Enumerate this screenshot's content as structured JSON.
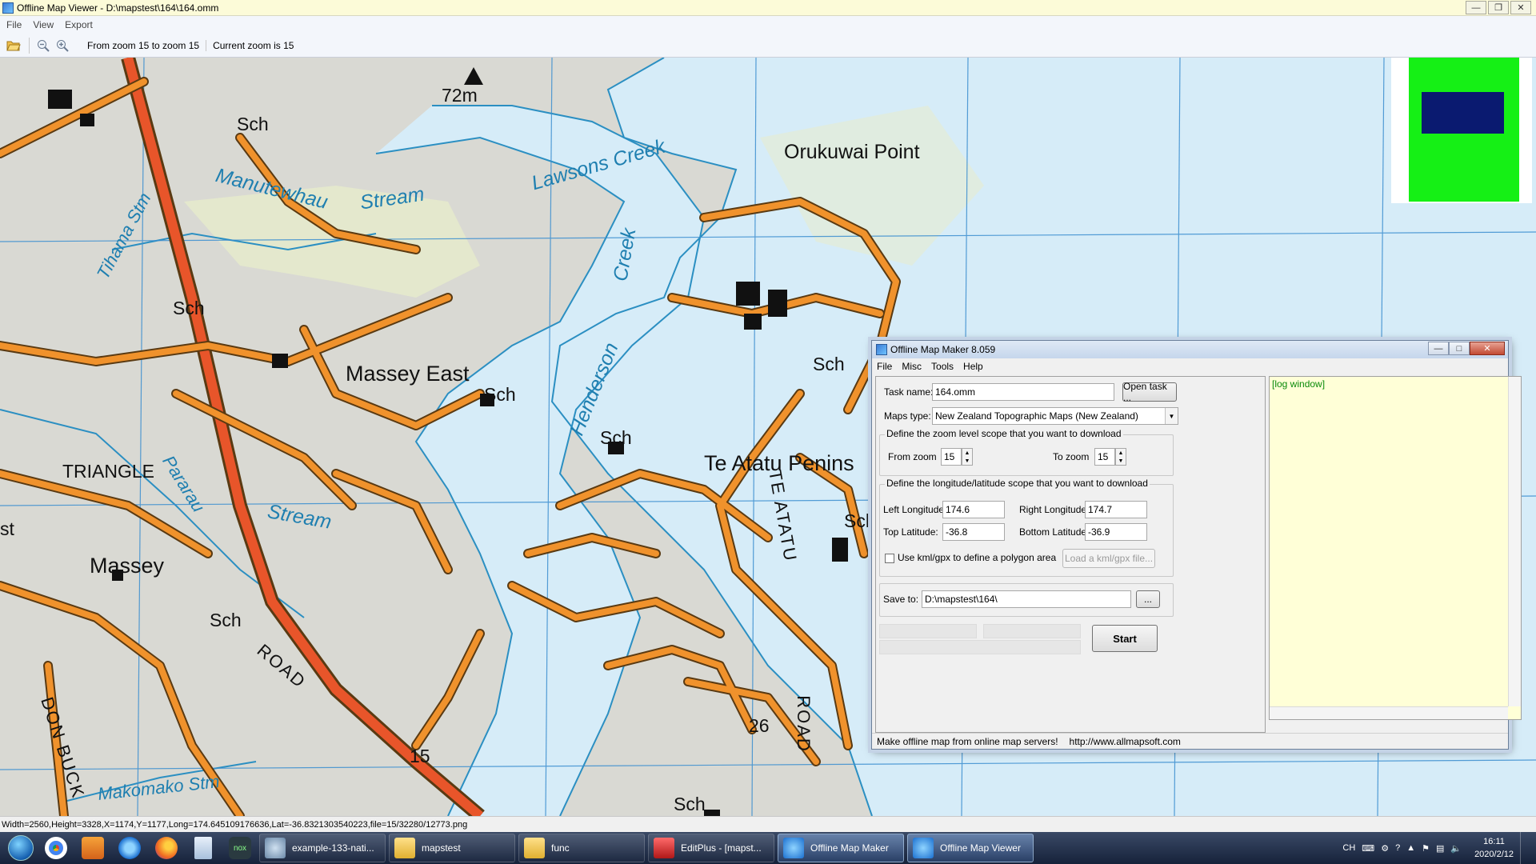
{
  "viewer": {
    "title": "Offline Map Viewer - D:\\mapstest\\164\\164.omm",
    "menu": [
      "File",
      "View",
      "Export"
    ],
    "toolbar": {
      "zoom_range_text": "From zoom 15 to zoom 15",
      "current_zoom_text": "Current zoom is 15",
      "icons": [
        "open-folder-icon",
        "zoom-out-icon",
        "zoom-in-icon"
      ]
    },
    "status": "Width=2560,Height=3328,X=1174,Y=1177,Long=174.645109176636,Lat=-36.8321303540223,file=15/32280/12773.png"
  },
  "map": {
    "place_labels": [
      "72m",
      "Sch",
      "Sch",
      "Sch",
      "Sch",
      "Sch",
      "Sch",
      "Sch",
      "Sch",
      "Massey East",
      "Massey",
      "TRIANGLE",
      "Orukuwai Point",
      "Te Atatu Penins",
      "15",
      "26",
      "st"
    ],
    "water_labels": [
      "Lawsons Creek",
      "Manutewhau",
      "Stream",
      "Tihama Stm",
      "Henderson",
      "Creek",
      "Pararau",
      "Stream",
      "Makomako Stm"
    ],
    "road_labels": [
      "ROAD",
      "ROAD",
      "TE ATATU",
      "DON BUCK"
    ],
    "colors": {
      "land": "#d9d9d3",
      "water": "#d6ecf8",
      "road": "#f0922c",
      "road_edge": "#5a3a12",
      "highway": "#e8552a",
      "grid": "#3a8ed0",
      "bush": "#e6ebcc"
    }
  },
  "minimap": {
    "colors": {
      "background": "#15f015",
      "viewport": "#0a1a70"
    }
  },
  "dialog": {
    "title": "Offline Map Maker 8.059",
    "menu": [
      "File",
      "Misc",
      "Tools",
      "Help"
    ],
    "task_name_label": "Task name:",
    "task_name_value": "164.omm",
    "open_task_button": "Open task ...",
    "maps_type_label": "Maps type:",
    "maps_type_value": "New Zealand Topographic Maps (New Zealand)",
    "zoom_group_title": "Define the zoom level scope that you want to download",
    "from_zoom_label": "From zoom",
    "from_zoom_value": "15",
    "to_zoom_label": "To zoom",
    "to_zoom_value": "15",
    "coord_group_title": "Define the longitude/latitude scope that you want to download",
    "left_longitude_label": "Left Longitude:",
    "left_longitude_value": "174.6",
    "right_longitude_label": "Right Longitude:",
    "right_longitude_value": "174.7",
    "top_latitude_label": "Top Latitude:",
    "top_latitude_value": "-36.8",
    "bottom_latitude_label": "Bottom Latitude:",
    "bottom_latitude_value": "-36.9",
    "use_kml_label": "Use kml/gpx to define a polygon area",
    "load_kml_button": "Load a kml/gpx file...",
    "save_to_label": "Save to:",
    "save_to_value": "D:\\mapstest\\164\\",
    "browse_button": "...",
    "start_button": "Start",
    "log_text": "[log window]",
    "status_text": "Make offline map from online map servers!",
    "status_url": "http://www.allmapsoft.com"
  },
  "taskbar": {
    "pinned": [
      "chrome-icon",
      "media-player-icon",
      "internet-explorer-icon",
      "firefox-icon",
      "notepad-icon",
      "nox-icon"
    ],
    "tasks": [
      "example-133-nati...",
      "mapstest",
      "func",
      "EditPlus - [mapst...",
      "Offline Map Maker",
      "Offline Map Viewer"
    ],
    "tray_lang": "CH",
    "time": "16:11",
    "date": "2020/2/12"
  }
}
